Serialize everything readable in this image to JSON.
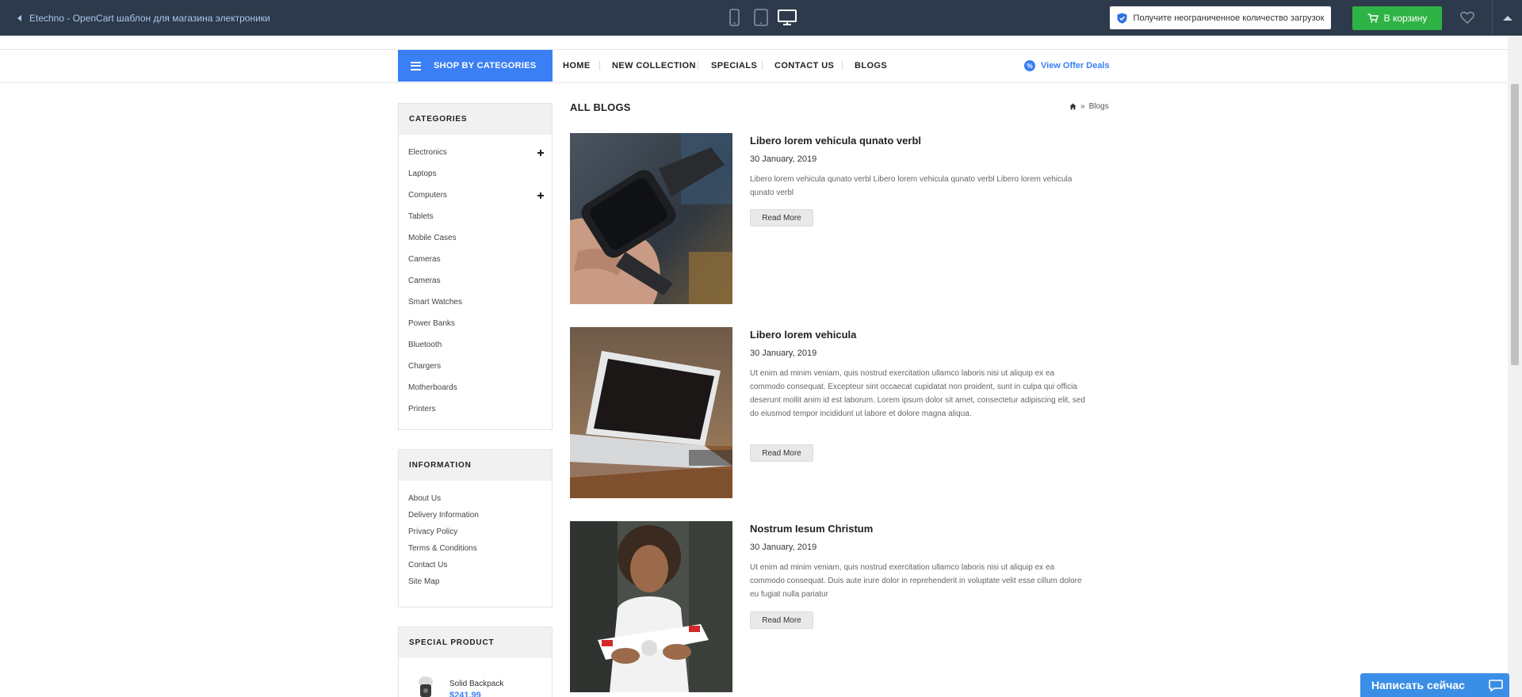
{
  "topbar": {
    "back_label": "Etechno - OpenCart шаблон для магазина электроники",
    "download_label": "Получите неограниченное количество загрузок",
    "cart_label": "В корзину",
    "icons": [
      "phone-view-icon",
      "tablet-view-icon",
      "desktop-view-icon",
      "shield-icon",
      "cart-icon",
      "heart-icon",
      "collapse-arrow-icon"
    ]
  },
  "header": {
    "shop_by_categories": "SHOP BY CATEGORIES",
    "nav": [
      "HOME",
      "NEW COLLECTION",
      "SPECIALS",
      "CONTACT US",
      "BLOGS"
    ],
    "offer_label": "View Offer Deals",
    "offer_icon": "%"
  },
  "sidebar": {
    "categories_title": "CATEGORIES",
    "categories": [
      {
        "label": "Electronics",
        "expandable": true
      },
      {
        "label": "Laptops",
        "expandable": false
      },
      {
        "label": "Computers",
        "expandable": true
      },
      {
        "label": "Tablets",
        "expandable": false
      },
      {
        "label": "Mobile Cases",
        "expandable": false
      },
      {
        "label": "Cameras",
        "expandable": false
      },
      {
        "label": "Cameras",
        "expandable": false
      },
      {
        "label": "Smart Watches",
        "expandable": false
      },
      {
        "label": "Power Banks",
        "expandable": false
      },
      {
        "label": "Bluetooth",
        "expandable": false
      },
      {
        "label": "Chargers",
        "expandable": false
      },
      {
        "label": "Motherboards",
        "expandable": false
      },
      {
        "label": "Printers",
        "expandable": false
      }
    ],
    "information_title": "INFORMATION",
    "information": [
      "About Us",
      "Delivery Information",
      "Privacy Policy",
      "Terms & Conditions",
      "Contact Us",
      "Site Map"
    ],
    "special_title": "SPECIAL PRODUCT",
    "special_product": {
      "name": "Solid Backpack",
      "price": "$241.99"
    }
  },
  "main": {
    "title": "ALL BLOGS",
    "breadcrumb": {
      "sep": "»",
      "current": "Blogs"
    },
    "posts": [
      {
        "title": "Libero lorem vehicula qunato verbl",
        "date": "30 January, 2019",
        "text": "Libero lorem vehicula qunato verbl Libero lorem vehicula qunato verbl Libero lorem vehicula qunato verbl",
        "read_more": "Read More",
        "image": "smartwatch-photo"
      },
      {
        "title": "Libero lorem vehicula",
        "date": "30 January, 2019",
        "text": "Ut enim ad minim veniam, quis nostrud exercitation ullamco laboris nisi ut aliquip ex ea commodo consequat. Excepteur sint occaecat cupidatat non proident, sunt in culpa qui officia deserunt mollit anim id est laborum. Lorem ipsum dolor sit amet, consectetur adipiscing elit, sed do eiusmod tempor incididunt ut labore et dolore magna aliqua.",
        "read_more": "Read More",
        "image": "laptop-photo"
      },
      {
        "title": "Nostrum Iesum Christum",
        "date": "30 January, 2019",
        "text": "Ut enim ad minim veniam, quis nostrud exercitation ullamco laboris nisi ut aliquip ex ea commodo consequat. Duis aute irure dolor in reprehenderit in voluptate velit esse cillum dolore eu fugiat nulla pariatur",
        "read_more": "Read More",
        "image": "drone-photo"
      }
    ]
  },
  "chat": {
    "label": "Написать сейчас"
  },
  "colors": {
    "topbar": "#2d3a4b",
    "accent": "#3b7ff5",
    "cart": "#2eb345",
    "chat": "#3b8ee6"
  }
}
